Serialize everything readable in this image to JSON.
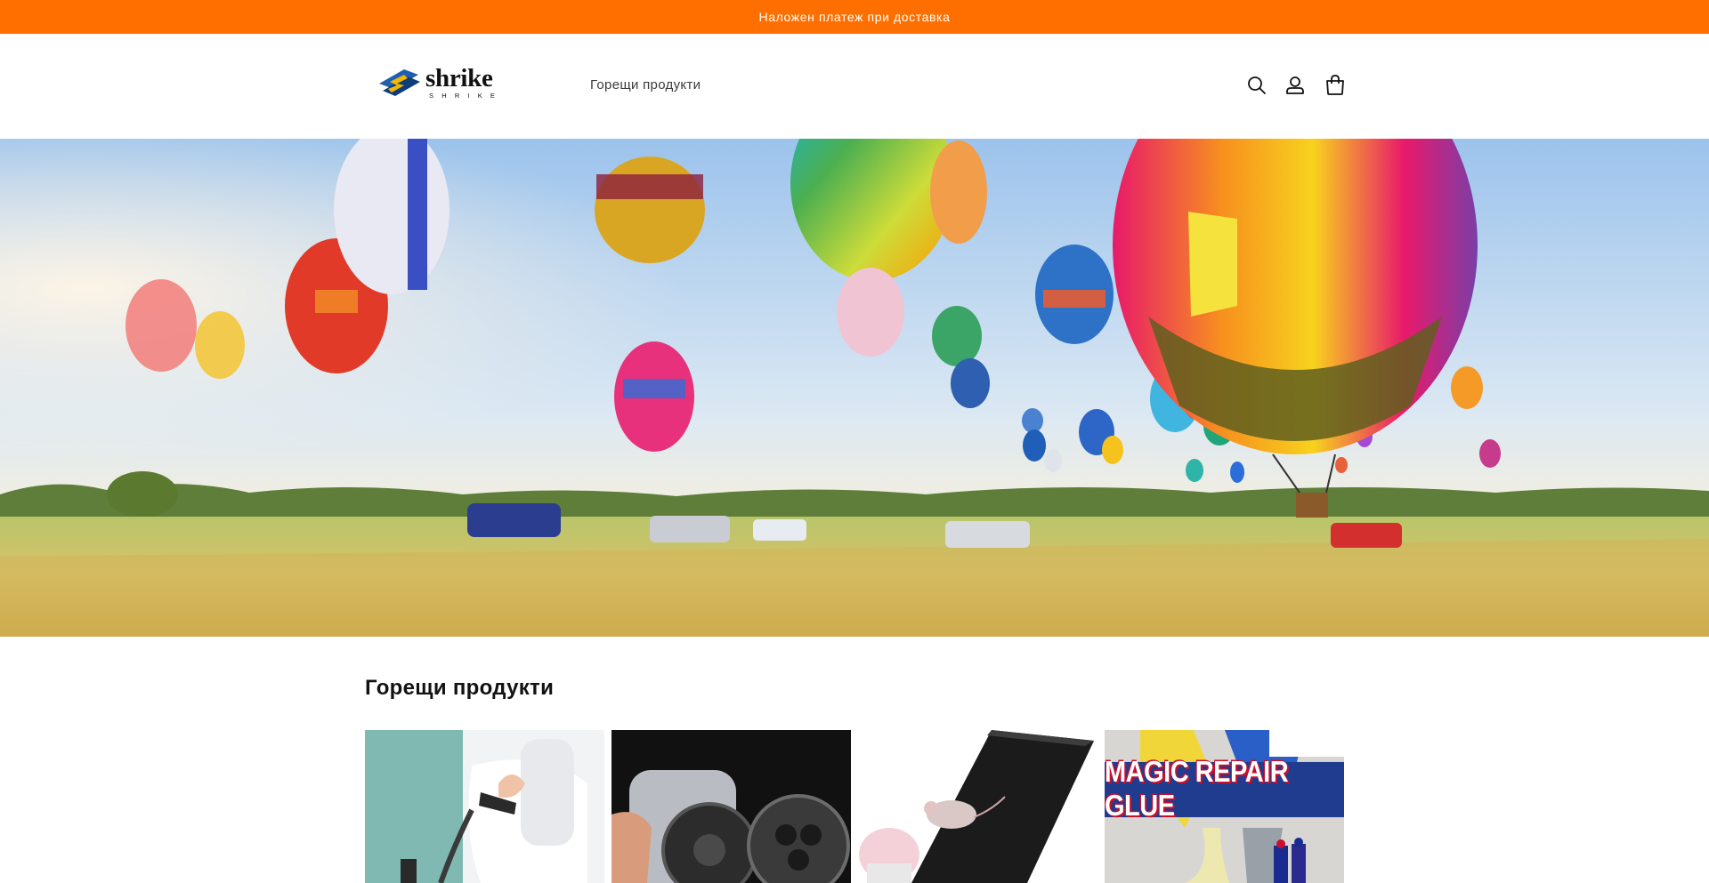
{
  "announcement": {
    "text": "Наложен платеж при доставка",
    "background": "#ff6f00"
  },
  "header": {
    "logo": {
      "name": "shrike",
      "subtitle": "SHRIKE",
      "icon": "shrike-logo-icon"
    },
    "nav": [
      {
        "label": "Горещи продукти"
      }
    ],
    "icons": [
      "search-icon",
      "account-icon",
      "cart-icon"
    ]
  },
  "hero": {
    "image": "hot-air-balloons-over-field"
  },
  "featured": {
    "title": "Горещи продукти",
    "products": [
      {
        "image": "bidet-sprayer-toilet"
      },
      {
        "image": "magnetic-phone-camera-holder"
      },
      {
        "image": "waterproof-tape-mouse"
      },
      {
        "image": "magic-repair-glue",
        "banner_text": "MAGIC REPAIR GLUE"
      }
    ]
  },
  "colors": {
    "accent": "#ff6f00",
    "logo_blue": "#1f5fae",
    "glue_banner": "#1f3c8f"
  }
}
